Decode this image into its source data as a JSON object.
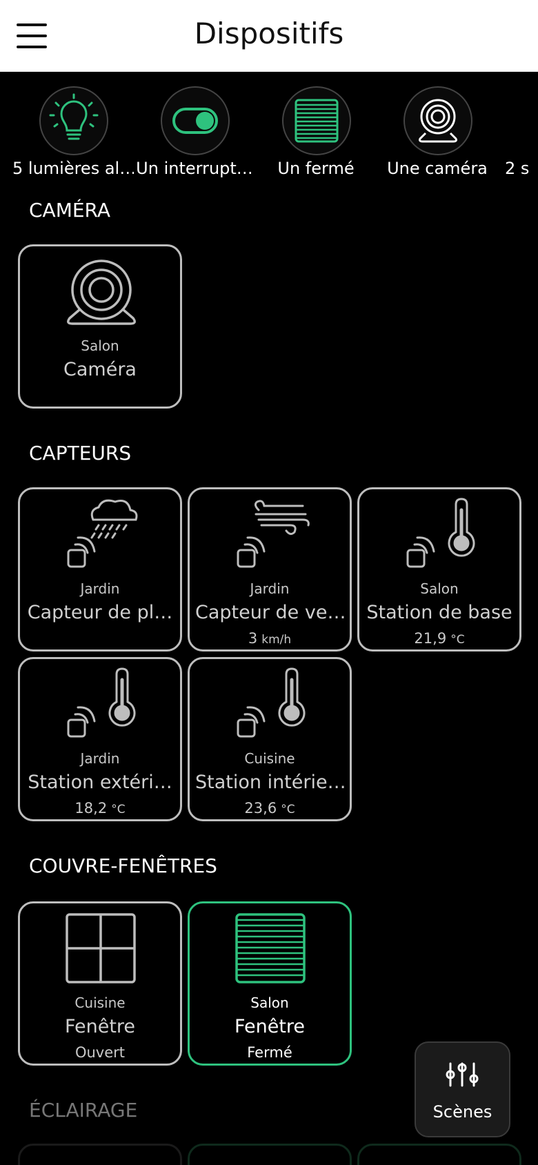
{
  "header": {
    "title": "Dispositifs",
    "menu_icon": "hamburger-menu-icon"
  },
  "summary": [
    {
      "icon": "lightbulb-icon",
      "label": "5 lumières al…"
    },
    {
      "icon": "toggle-switch-icon",
      "label": "Un interrupt…"
    },
    {
      "icon": "shutter-icon",
      "label": "Un fermé"
    },
    {
      "icon": "webcam-icon",
      "label": "Une caméra"
    },
    {
      "icon": "",
      "label": "2 s"
    }
  ],
  "sections": {
    "camera": {
      "title": "CAMÉRA",
      "cards": [
        {
          "icon": "webcam-icon",
          "room": "Salon",
          "name": "Caméra"
        }
      ]
    },
    "sensors": {
      "title": "CAPTEURS",
      "cards": [
        {
          "icon": "rain-sensor-icon",
          "room": "Jardin",
          "name": "Capteur de pl…"
        },
        {
          "icon": "wind-sensor-icon",
          "room": "Jardin",
          "name": "Capteur de ve…",
          "value": "3",
          "unit": "km/h"
        },
        {
          "icon": "thermometer-sensor-icon",
          "room": "Salon",
          "name": "Station de base",
          "value": "21,9",
          "unit": "°C"
        },
        {
          "icon": "thermometer-sensor-icon",
          "room": "Jardin",
          "name": "Station extéri…",
          "value": "18,2",
          "unit": "°C"
        },
        {
          "icon": "thermometer-sensor-icon",
          "room": "Cuisine",
          "name": "Station intérie…",
          "value": "23,6",
          "unit": "°C"
        }
      ]
    },
    "covers": {
      "title": "COUVRE-FENÊTRES",
      "cards": [
        {
          "icon": "window-icon",
          "room": "Cuisine",
          "name": "Fenêtre",
          "value": "Ouvert"
        },
        {
          "icon": "shutter-icon",
          "room": "Salon",
          "name": "Fenêtre",
          "value": "Fermé"
        }
      ]
    },
    "lighting": {
      "title": "ÉCLAIRAGE"
    }
  },
  "fab": {
    "icon": "sliders-icon",
    "label": "Scènes"
  },
  "colors": {
    "accent": "#2ec27e",
    "card_border": "#bdbdbd",
    "background": "#000000",
    "header_bg": "#ffffff"
  }
}
